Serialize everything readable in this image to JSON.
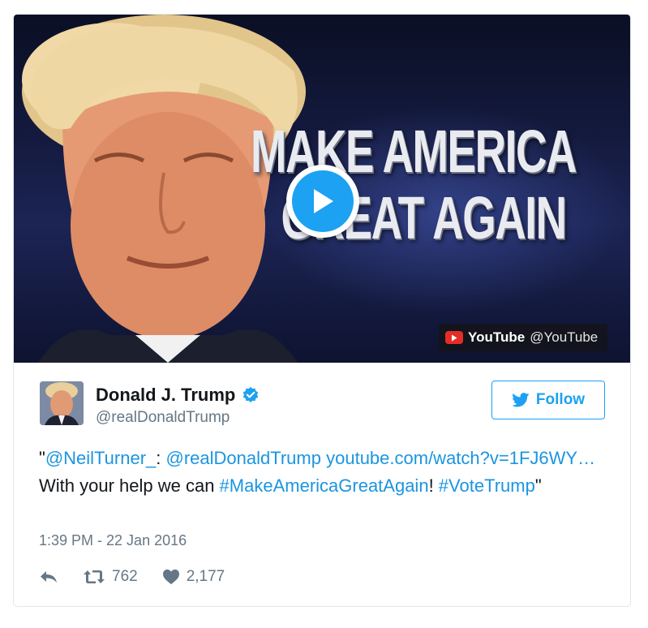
{
  "video": {
    "headline_line1": "MAKE AMERICA",
    "headline_line2": "GREAT AGAIN",
    "source_brand": "YouTube",
    "source_handle": "@YouTube"
  },
  "author": {
    "name": "Donald J. Trump",
    "handle": "@realDonaldTrump",
    "verified": true
  },
  "follow_button": {
    "label": "Follow"
  },
  "tweet": {
    "parts": [
      {
        "text": "\"",
        "link": false
      },
      {
        "text": "@NeilTurner_",
        "link": true
      },
      {
        "text": ": ",
        "link": false
      },
      {
        "text": "@realDonaldTrump",
        "link": true
      },
      {
        "text": " ",
        "link": false
      },
      {
        "text": "youtube.com/watch?v=1FJ6WY…",
        "link": true
      },
      {
        "text": " With your help we can ",
        "link": false
      },
      {
        "text": "#MakeAmericaGreatAgain",
        "link": true
      },
      {
        "text": "! ",
        "link": false
      },
      {
        "text": "#VoteTrump",
        "link": true
      },
      {
        "text": "\"",
        "link": false
      }
    ]
  },
  "timestamp": "1:39 PM - 22 Jan 2016",
  "stats": {
    "retweets": "762",
    "likes": "2,177"
  },
  "colors": {
    "accent": "#1da1f2",
    "link": "#1b95e0",
    "muted": "#657786",
    "youtube_red": "#e52d27"
  }
}
